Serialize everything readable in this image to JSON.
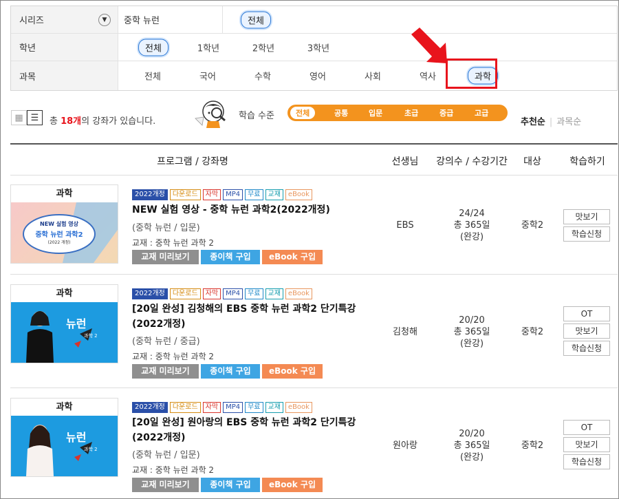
{
  "filters": {
    "series_label": "시리즈",
    "series_value": "중학 뉴런",
    "series_option": "전체",
    "grade_label": "학년",
    "grades": [
      "전체",
      "1학년",
      "2학년",
      "3학년"
    ],
    "subject_label": "과목",
    "subjects": [
      "전체",
      "국어",
      "수학",
      "영어",
      "사회",
      "역사",
      "과학"
    ]
  },
  "toolbar": {
    "count_prefix": "총 ",
    "count_value": "18개",
    "count_suffix": "의 강좌가 있습니다.",
    "level_label": "학습 수준",
    "levels": [
      "전체",
      "공통",
      "입문",
      "초급",
      "중급",
      "고급"
    ],
    "sort_active": "추천순",
    "sort_other": "과목순"
  },
  "table_headers": [
    "프로그램 / 강좌명",
    "선생님",
    "강의수 / 수강기간",
    "대상",
    "학습하기"
  ],
  "courses": [
    {
      "category": "과학",
      "badges": [
        "2022개정",
        "다운로드",
        "자막",
        "MP4",
        "무료",
        "교재",
        "eBook"
      ],
      "title": "NEW 실험 영상 - 중학 뉴런 과학2(2022개정)",
      "sub": "(중학 뉴런 / 입문)",
      "book": "교재 : 중학 뉴런 과학 2",
      "actions": [
        "교재 미리보기",
        "종이책 구입",
        "eBook 구입"
      ],
      "teacher": "EBS",
      "lectures": "24/24",
      "period": "총 365일",
      "period_note": "(완강)",
      "target": "중학2",
      "buttons": [
        "맛보기",
        "학습신청"
      ],
      "thumb_caption_1": "NEW 실험 영상",
      "thumb_caption_2": "중학 뉴런 과학2",
      "thumb_caption_3": "(2022 개정)"
    },
    {
      "category": "과학",
      "badges": [
        "2022개정",
        "다운로드",
        "자막",
        "MP4",
        "무료",
        "교재",
        "eBook"
      ],
      "title": "[20일 완성] 김청해의 EBS 중학 뉴런 과학2 단기특강(2022개정)",
      "sub": "(중학 뉴런 / 중급)",
      "book": "교재 : 중학 뉴런 과학 2",
      "actions": [
        "교재 미리보기",
        "종이책 구입",
        "eBook 구입"
      ],
      "teacher": "김청해",
      "lectures": "20/20",
      "period": "총 365일",
      "period_note": "(완강)",
      "target": "중학2",
      "buttons": [
        "OT",
        "맛보기",
        "학습신청"
      ],
      "thumb_caption_1": "뉴런",
      "thumb_caption_2": "과학 2"
    },
    {
      "category": "과학",
      "badges": [
        "2022개정",
        "다운로드",
        "자막",
        "MP4",
        "무료",
        "교재",
        "eBook"
      ],
      "title": "[20일 완성] 원아랑의 EBS 중학 뉴런 과학2 단기특강(2022개정)",
      "sub": "(중학 뉴런 / 입문)",
      "book": "교재 : 중학 뉴런 과학 2",
      "actions": [
        "교재 미리보기",
        "종이책 구입",
        "eBook 구입"
      ],
      "teacher": "원아랑",
      "lectures": "20/20",
      "period": "총 365일",
      "period_note": "(완강)",
      "target": "중학2",
      "buttons": [
        "OT",
        "맛보기",
        "학습신청"
      ],
      "thumb_caption_1": "뉴런",
      "thumb_caption_2": "과학 2"
    }
  ],
  "colors": {
    "accent_blue": "#2a77d4",
    "highlight_red": "#e8141c",
    "level_orange": "#f3931e"
  }
}
